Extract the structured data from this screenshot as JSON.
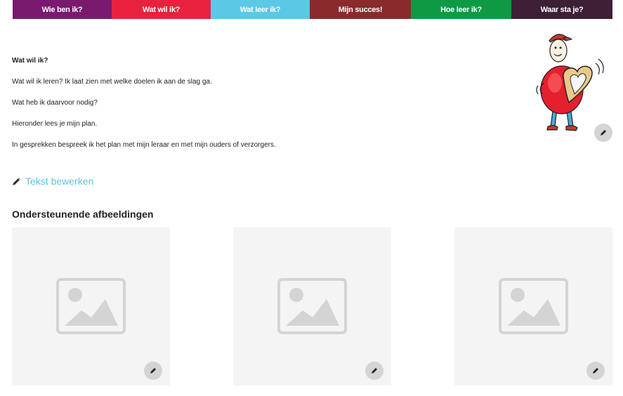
{
  "tabs": [
    {
      "label": "Wie ben ik?",
      "color": "#7a1a6e"
    },
    {
      "label": "Wat wil ik?",
      "color": "#e8213f"
    },
    {
      "label": "Wat leer ik?",
      "color": "#5bc8e6"
    },
    {
      "label": "Mijn succes!",
      "color": "#8a2a2c"
    },
    {
      "label": "Hoe leer ik?",
      "color": "#0e9a44"
    },
    {
      "label": "Waar sta je?",
      "color": "#3e2036"
    }
  ],
  "intro": {
    "heading": "Wat wil ik?",
    "line1": "Wat wil ik leren? Ik laat zien met welke doelen ik aan de slag ga.",
    "line2": "Wat heb ik daarvoor nodig?",
    "line3": "Hieronder lees je mijn plan.",
    "line4": "In gesprekken bespreek ik het plan met mijn leraar en met mijn ouders of verzorgers."
  },
  "edit_link": {
    "label": "Tekst bewerken",
    "icon": "pencil-icon"
  },
  "images_section": {
    "title": "Ondersteunende afbeeldingen"
  },
  "accent_color": "#5bc4e1"
}
